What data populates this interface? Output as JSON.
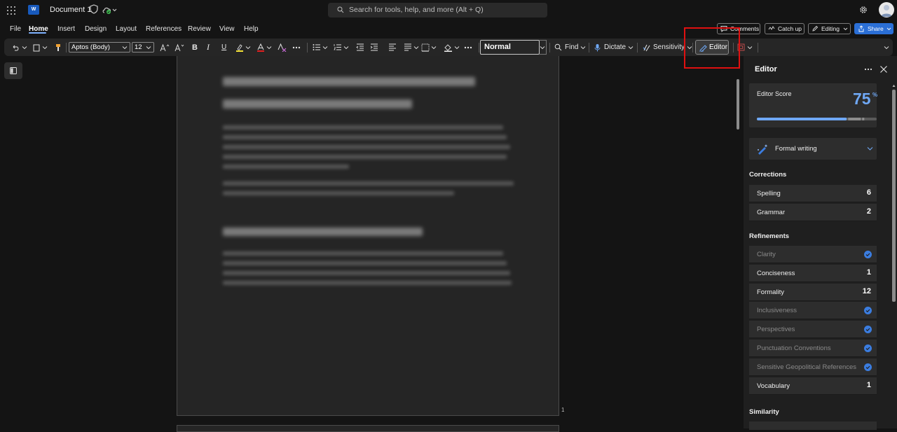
{
  "app": {
    "document_title": "Document 1",
    "app_icon_letter": "W",
    "search_placeholder": "Search for tools, help, and more (Alt + Q)"
  },
  "menu": {
    "tabs": [
      "File",
      "Home",
      "Insert",
      "Design",
      "Layout",
      "References",
      "Review",
      "View",
      "Help"
    ],
    "active_tab": "Home"
  },
  "top_buttons": {
    "comments": "Comments",
    "catch_up": "Catch up",
    "editing": "Editing",
    "share": "Share"
  },
  "ribbon": {
    "font_name": "Aptos (Body)",
    "font_size": "12",
    "bold": "B",
    "italic": "I",
    "underline": "U",
    "style": "Normal",
    "find": "Find",
    "dictate": "Dictate",
    "sensitivity": "Sensitivity",
    "editor": "Editor"
  },
  "page": {
    "page_number": "1"
  },
  "editor_pane": {
    "title": "Editor",
    "score_label": "Editor Score",
    "score_value": "75",
    "score_unit": "%",
    "score_fraction": 0.75,
    "writing_style": "Formal writing",
    "corrections_header": "Corrections",
    "corrections": [
      {
        "label": "Spelling",
        "count": "6"
      },
      {
        "label": "Grammar",
        "count": "2"
      }
    ],
    "refinements_header": "Refinements",
    "refinements": [
      {
        "label": "Clarity",
        "count": "",
        "done": true
      },
      {
        "label": "Conciseness",
        "count": "1",
        "done": false
      },
      {
        "label": "Formality",
        "count": "12",
        "done": false
      },
      {
        "label": "Inclusiveness",
        "count": "",
        "done": true
      },
      {
        "label": "Perspectives",
        "count": "",
        "done": true
      },
      {
        "label": "Punctuation Conventions",
        "count": "",
        "done": true
      },
      {
        "label": "Sensitive Geopolitical References",
        "count": "",
        "done": true
      },
      {
        "label": "Vocabulary",
        "count": "1",
        "done": false
      }
    ],
    "similarity_header": "Similarity"
  },
  "colors": {
    "accent": "#2b6fd6",
    "score": "#6fa8f5",
    "highlight": "#e01010"
  }
}
